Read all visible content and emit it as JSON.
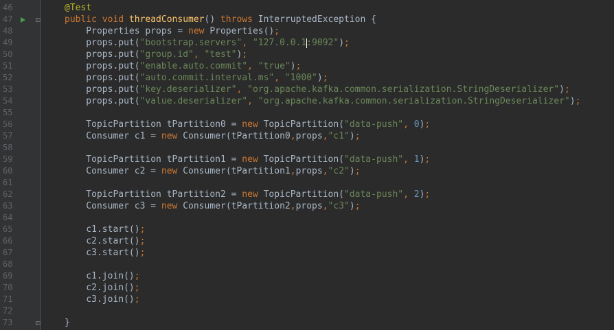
{
  "editor": {
    "lines": [
      {
        "n": "46",
        "t": [
          {
            "c": "ann",
            "v": "@Test"
          }
        ]
      },
      {
        "n": "47",
        "t": [
          {
            "c": "kw",
            "v": "public void "
          },
          {
            "c": "fn",
            "v": "threadConsumer"
          },
          {
            "c": "id",
            "v": "() "
          },
          {
            "c": "kw",
            "v": "throws "
          },
          {
            "c": "id",
            "v": "InterruptedException {"
          }
        ]
      },
      {
        "n": "48",
        "t": [
          {
            "c": "id",
            "v": "    Properties props = "
          },
          {
            "c": "kw",
            "v": "new "
          },
          {
            "c": "id",
            "v": "Properties()"
          },
          {
            "c": "kw",
            "v": ";"
          }
        ]
      },
      {
        "n": "49",
        "t": [
          {
            "c": "id",
            "v": "    props.put("
          },
          {
            "c": "str",
            "v": "\"bootstrap.servers\""
          },
          {
            "c": "kw",
            "v": ", "
          },
          {
            "c": "str",
            "v": "\"127.0.0.1"
          },
          {
            "c": "caret",
            "v": ""
          },
          {
            "c": "str",
            "v": ":9092\""
          },
          {
            "c": "id",
            "v": ")"
          },
          {
            "c": "kw",
            "v": ";"
          }
        ]
      },
      {
        "n": "50",
        "t": [
          {
            "c": "id",
            "v": "    props.put("
          },
          {
            "c": "str",
            "v": "\"group.id\""
          },
          {
            "c": "kw",
            "v": ", "
          },
          {
            "c": "str",
            "v": "\"test\""
          },
          {
            "c": "id",
            "v": ")"
          },
          {
            "c": "kw",
            "v": ";"
          }
        ]
      },
      {
        "n": "51",
        "t": [
          {
            "c": "id",
            "v": "    props.put("
          },
          {
            "c": "str",
            "v": "\"enable.auto.commit\""
          },
          {
            "c": "kw",
            "v": ", "
          },
          {
            "c": "str",
            "v": "\"true\""
          },
          {
            "c": "id",
            "v": ")"
          },
          {
            "c": "kw",
            "v": ";"
          }
        ]
      },
      {
        "n": "52",
        "t": [
          {
            "c": "id",
            "v": "    props.put("
          },
          {
            "c": "str",
            "v": "\"auto.commit.interval.ms\""
          },
          {
            "c": "kw",
            "v": ", "
          },
          {
            "c": "str",
            "v": "\"1000\""
          },
          {
            "c": "id",
            "v": ")"
          },
          {
            "c": "kw",
            "v": ";"
          }
        ]
      },
      {
        "n": "53",
        "t": [
          {
            "c": "id",
            "v": "    props.put("
          },
          {
            "c": "str",
            "v": "\"key.deserializer\""
          },
          {
            "c": "kw",
            "v": ", "
          },
          {
            "c": "str",
            "v": "\"org.apache.kafka.common.serialization.StringDeserializer\""
          },
          {
            "c": "id",
            "v": ")"
          },
          {
            "c": "kw",
            "v": ";"
          }
        ]
      },
      {
        "n": "54",
        "t": [
          {
            "c": "id",
            "v": "    props.put("
          },
          {
            "c": "str",
            "v": "\"value.deserializer\""
          },
          {
            "c": "kw",
            "v": ", "
          },
          {
            "c": "str",
            "v": "\"org.apache.kafka.common.serialization.StringDeserializer\""
          },
          {
            "c": "id",
            "v": ")"
          },
          {
            "c": "kw",
            "v": ";"
          }
        ]
      },
      {
        "n": "55",
        "t": []
      },
      {
        "n": "56",
        "t": [
          {
            "c": "id",
            "v": "    TopicPartition tPartition0 = "
          },
          {
            "c": "kw",
            "v": "new "
          },
          {
            "c": "id",
            "v": "TopicPartition("
          },
          {
            "c": "str",
            "v": "\"data-push\""
          },
          {
            "c": "kw",
            "v": ", "
          },
          {
            "c": "num",
            "v": "0"
          },
          {
            "c": "id",
            "v": ")"
          },
          {
            "c": "kw",
            "v": ";"
          }
        ]
      },
      {
        "n": "57",
        "t": [
          {
            "c": "id",
            "v": "    Consumer c1 = "
          },
          {
            "c": "kw",
            "v": "new "
          },
          {
            "c": "id",
            "v": "Consumer(tPartition0"
          },
          {
            "c": "kw",
            "v": ","
          },
          {
            "c": "id",
            "v": "props"
          },
          {
            "c": "kw",
            "v": ","
          },
          {
            "c": "str",
            "v": "\"c1\""
          },
          {
            "c": "id",
            "v": ")"
          },
          {
            "c": "kw",
            "v": ";"
          }
        ]
      },
      {
        "n": "58",
        "t": []
      },
      {
        "n": "59",
        "t": [
          {
            "c": "id",
            "v": "    TopicPartition tPartition1 = "
          },
          {
            "c": "kw",
            "v": "new "
          },
          {
            "c": "id",
            "v": "TopicPartition("
          },
          {
            "c": "str",
            "v": "\"data-push\""
          },
          {
            "c": "kw",
            "v": ", "
          },
          {
            "c": "num",
            "v": "1"
          },
          {
            "c": "id",
            "v": ")"
          },
          {
            "c": "kw",
            "v": ";"
          }
        ]
      },
      {
        "n": "60",
        "t": [
          {
            "c": "id",
            "v": "    Consumer c2 = "
          },
          {
            "c": "kw",
            "v": "new "
          },
          {
            "c": "id",
            "v": "Consumer(tPartition1"
          },
          {
            "c": "kw",
            "v": ","
          },
          {
            "c": "id",
            "v": "props"
          },
          {
            "c": "kw",
            "v": ","
          },
          {
            "c": "str",
            "v": "\"c2\""
          },
          {
            "c": "id",
            "v": ")"
          },
          {
            "c": "kw",
            "v": ";"
          }
        ]
      },
      {
        "n": "61",
        "t": []
      },
      {
        "n": "62",
        "t": [
          {
            "c": "id",
            "v": "    TopicPartition tPartition2 = "
          },
          {
            "c": "kw",
            "v": "new "
          },
          {
            "c": "id",
            "v": "TopicPartition("
          },
          {
            "c": "str",
            "v": "\"data-push\""
          },
          {
            "c": "kw",
            "v": ", "
          },
          {
            "c": "num",
            "v": "2"
          },
          {
            "c": "id",
            "v": ")"
          },
          {
            "c": "kw",
            "v": ";"
          }
        ]
      },
      {
        "n": "63",
        "t": [
          {
            "c": "id",
            "v": "    Consumer c3 = "
          },
          {
            "c": "kw",
            "v": "new "
          },
          {
            "c": "id",
            "v": "Consumer(tPartition2"
          },
          {
            "c": "kw",
            "v": ","
          },
          {
            "c": "id",
            "v": "props"
          },
          {
            "c": "kw",
            "v": ","
          },
          {
            "c": "str",
            "v": "\"c3\""
          },
          {
            "c": "id",
            "v": ")"
          },
          {
            "c": "kw",
            "v": ";"
          }
        ]
      },
      {
        "n": "64",
        "t": []
      },
      {
        "n": "65",
        "t": [
          {
            "c": "id",
            "v": "    c1.start()"
          },
          {
            "c": "kw",
            "v": ";"
          }
        ]
      },
      {
        "n": "66",
        "t": [
          {
            "c": "id",
            "v": "    c2.start()"
          },
          {
            "c": "kw",
            "v": ";"
          }
        ]
      },
      {
        "n": "67",
        "t": [
          {
            "c": "id",
            "v": "    c3.start()"
          },
          {
            "c": "kw",
            "v": ";"
          }
        ]
      },
      {
        "n": "68",
        "t": []
      },
      {
        "n": "69",
        "t": [
          {
            "c": "id",
            "v": "    c1.join()"
          },
          {
            "c": "kw",
            "v": ";"
          }
        ]
      },
      {
        "n": "70",
        "t": [
          {
            "c": "id",
            "v": "    c2.join()"
          },
          {
            "c": "kw",
            "v": ";"
          }
        ]
      },
      {
        "n": "71",
        "t": [
          {
            "c": "id",
            "v": "    c3.join()"
          },
          {
            "c": "kw",
            "v": ";"
          }
        ]
      },
      {
        "n": "72",
        "t": []
      },
      {
        "n": "73",
        "t": [
          {
            "c": "id",
            "v": "}"
          }
        ]
      }
    ]
  },
  "icons": {
    "run": "run-test-icon",
    "fold": "fold-marker-icon"
  },
  "colors": {
    "background": "#2b2b2b",
    "gutter": "#313335",
    "keyword": "#cc7832",
    "string": "#6a8759",
    "number": "#6897bb",
    "method": "#ffc66d",
    "annotation": "#bbb529",
    "identifier": "#a9b7c6"
  }
}
